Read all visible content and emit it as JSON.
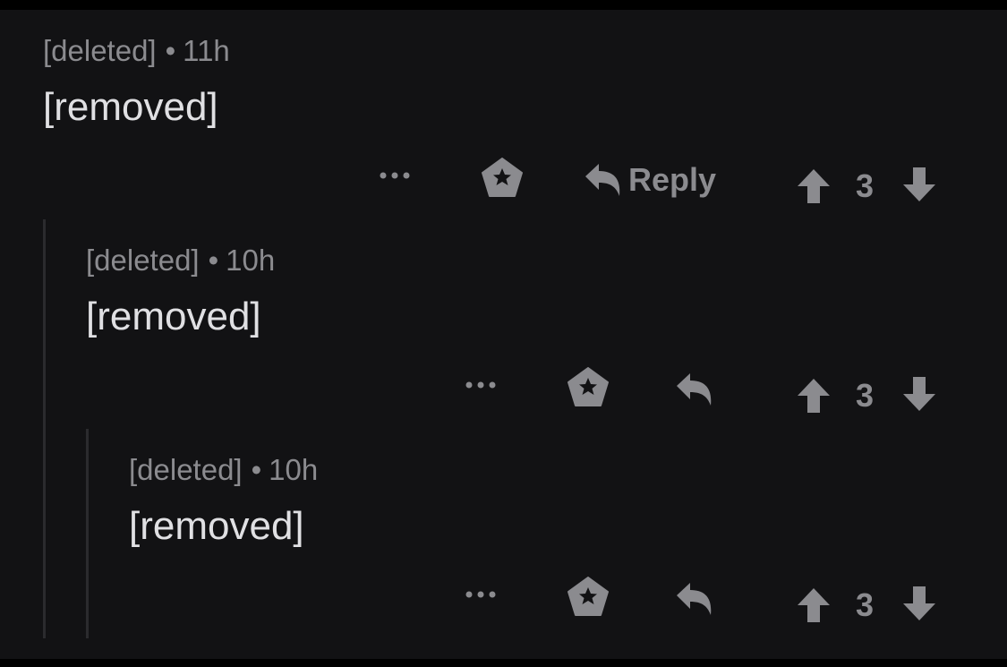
{
  "comments": [
    {
      "author": "[deleted]",
      "separator": "•",
      "age": "11h",
      "body": "[removed]",
      "reply_label": "Reply",
      "score": "3"
    },
    {
      "author": "[deleted]",
      "separator": "•",
      "age": "10h",
      "body": "[removed]",
      "reply_label": "",
      "score": "3"
    },
    {
      "author": "[deleted]",
      "separator": "•",
      "age": "10h",
      "body": "[removed]",
      "reply_label": "",
      "score": "3"
    }
  ],
  "icons": {
    "more": "more-options-icon",
    "award": "award-icon",
    "reply": "reply-icon",
    "upvote": "upvote-arrow-icon",
    "downvote": "downvote-arrow-icon"
  },
  "colors": {
    "background": "#121214",
    "meta_text": "#8b8b8f",
    "body_text": "#e0e0e3",
    "thread_line": "#2b2b2e"
  }
}
